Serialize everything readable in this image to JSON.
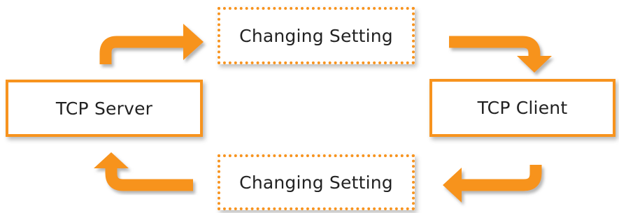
{
  "diagram": {
    "nodes": {
      "server": "TCP Server",
      "client": "TCP Client",
      "setting_top": "Changing Setting",
      "setting_bottom": "Changing Setting"
    },
    "colors": {
      "accent": "#f7931e",
      "shadow": "#7a7a7a",
      "text": "#222222",
      "background": "#ffffff"
    },
    "edges": [
      {
        "from": "server",
        "to": "setting_top",
        "icon": "curved-arrow-right-icon"
      },
      {
        "from": "setting_top",
        "to": "client",
        "icon": "curved-arrow-down-icon"
      },
      {
        "from": "client",
        "to": "setting_bottom",
        "icon": "curved-arrow-left-icon"
      },
      {
        "from": "setting_bottom",
        "to": "server",
        "icon": "curved-arrow-up-icon"
      }
    ]
  }
}
